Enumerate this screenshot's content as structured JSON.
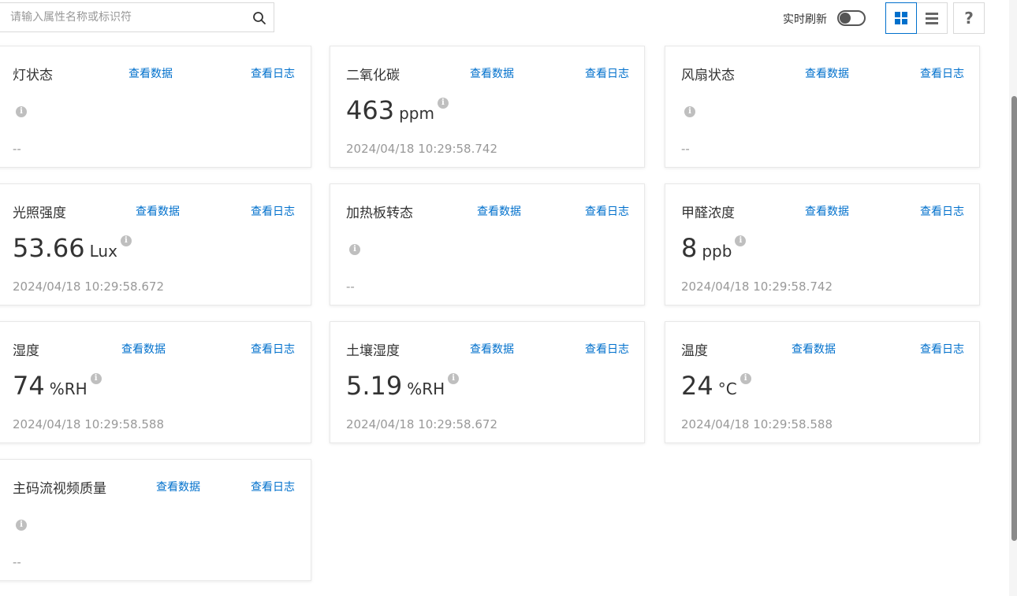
{
  "search": {
    "placeholder": "请输入属性名称或标识符",
    "icon": "search-icon"
  },
  "toolbar": {
    "refresh_label": "实时刷新",
    "refresh_on": false,
    "help_label": "?"
  },
  "accent_color": "#0070cc",
  "cards": [
    {
      "title": "灯状态",
      "data_link": "查看数据",
      "log_link": "查看日志",
      "value": "",
      "unit": "",
      "timestamp": "--"
    },
    {
      "title": "二氧化碳",
      "data_link": "查看数据",
      "log_link": "查看日志",
      "value": "463",
      "unit": "ppm",
      "timestamp": "2024/04/18 10:29:58.742"
    },
    {
      "title": "风扇状态",
      "data_link": "查看数据",
      "log_link": "查看日志",
      "value": "",
      "unit": "",
      "timestamp": "--"
    },
    {
      "title": "光照强度",
      "data_link": "查看数据",
      "log_link": "查看日志",
      "value": "53.66",
      "unit": "Lux",
      "timestamp": "2024/04/18 10:29:58.672"
    },
    {
      "title": "加热板转态",
      "data_link": "查看数据",
      "log_link": "查看日志",
      "value": "",
      "unit": "",
      "timestamp": "--"
    },
    {
      "title": "甲醛浓度",
      "data_link": "查看数据",
      "log_link": "查看日志",
      "value": "8",
      "unit": "ppb",
      "timestamp": "2024/04/18 10:29:58.742"
    },
    {
      "title": "湿度",
      "data_link": "查看数据",
      "log_link": "查看日志",
      "value": "74",
      "unit": "%RH",
      "timestamp": "2024/04/18 10:29:58.588"
    },
    {
      "title": "土壤湿度",
      "data_link": "查看数据",
      "log_link": "查看日志",
      "value": "5.19",
      "unit": "%RH",
      "timestamp": "2024/04/18 10:29:58.672"
    },
    {
      "title": "温度",
      "data_link": "查看数据",
      "log_link": "查看日志",
      "value": "24",
      "unit": "°C",
      "timestamp": "2024/04/18 10:29:58.588"
    },
    {
      "title": "主码流视频质量",
      "data_link": "查看数据",
      "log_link": "查看日志",
      "value": "",
      "unit": "",
      "timestamp": "--"
    }
  ]
}
